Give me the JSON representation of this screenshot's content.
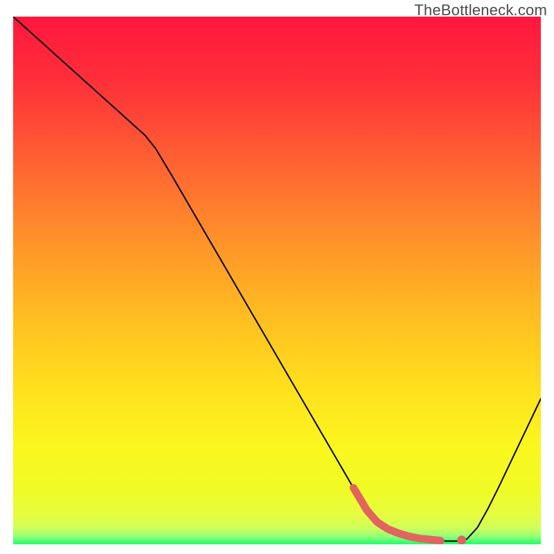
{
  "watermark": "TheBottleneck.com",
  "chart_data": {
    "type": "line",
    "title": "",
    "xlabel": "",
    "ylabel": "",
    "xlim": [
      0,
      100
    ],
    "ylim": [
      0,
      100
    ],
    "x": [
      0,
      5,
      10,
      15,
      20,
      25,
      27,
      30,
      35,
      40,
      45,
      50,
      55,
      60,
      65,
      68,
      70,
      72,
      74,
      76,
      78,
      80,
      82,
      84,
      86,
      88,
      90,
      92,
      94,
      96,
      98,
      100
    ],
    "y": [
      100,
      95.5,
      91,
      86.5,
      82,
      77.5,
      75,
      70,
      61.4,
      52.8,
      44.2,
      35.6,
      27,
      18.4,
      9.8,
      5.5,
      3.5,
      2.4,
      1.8,
      1.3,
      1.0,
      0.8,
      0.6,
      0.6,
      1.0,
      3.2,
      6.8,
      10.8,
      15.0,
      19.2,
      23.4,
      27.6
    ],
    "highlight_segment": {
      "x": [
        64.5,
        67,
        69,
        71,
        73,
        75,
        77,
        79,
        81
      ],
      "y": [
        10.7,
        6.5,
        4.2,
        2.9,
        2.1,
        1.5,
        1.1,
        0.9,
        0.7
      ]
    },
    "highlight_point": {
      "x": 85,
      "y": 0.8
    },
    "gradient_stops": [
      {
        "offset": 0.0,
        "color": "#ff173e"
      },
      {
        "offset": 0.12,
        "color": "#ff2f3a"
      },
      {
        "offset": 0.26,
        "color": "#ff5d33"
      },
      {
        "offset": 0.4,
        "color": "#ff8a2b"
      },
      {
        "offset": 0.55,
        "color": "#ffb822"
      },
      {
        "offset": 0.7,
        "color": "#ffdf1d"
      },
      {
        "offset": 0.82,
        "color": "#faf71f"
      },
      {
        "offset": 0.9,
        "color": "#f0fb27"
      },
      {
        "offset": 0.945,
        "color": "#e5fd41"
      },
      {
        "offset": 0.97,
        "color": "#cdfe5b"
      },
      {
        "offset": 0.985,
        "color": "#93ff79"
      },
      {
        "offset": 1.0,
        "color": "#20ff6b"
      }
    ]
  }
}
